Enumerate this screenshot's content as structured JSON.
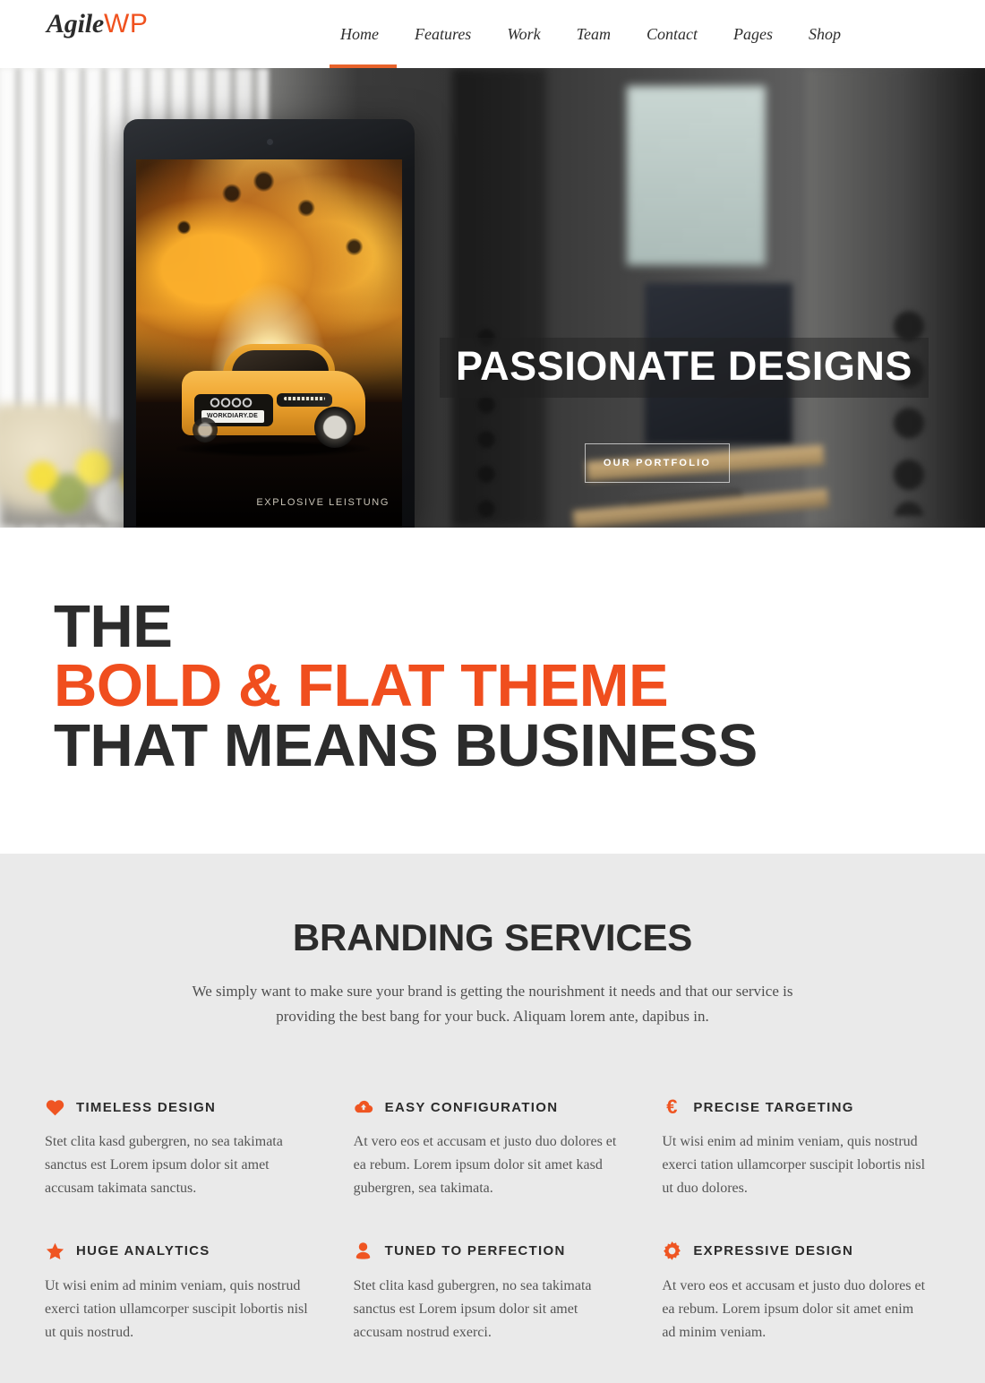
{
  "header": {
    "logo": {
      "part1": "Agile",
      "part2": "WP"
    },
    "nav": [
      {
        "label": "Home",
        "active": true
      },
      {
        "label": "Features",
        "active": false
      },
      {
        "label": "Work",
        "active": false
      },
      {
        "label": "Team",
        "active": false
      },
      {
        "label": "Contact",
        "active": false
      },
      {
        "label": "Pages",
        "active": false
      },
      {
        "label": "Shop",
        "active": false
      }
    ]
  },
  "hero": {
    "title": "PASSIONATE DESIGNS",
    "button_label": "OUR PORTFOLIO",
    "device": {
      "license_plate": "WORKDIARY.DE",
      "caption": "EXPLOSIVE LEISTUNG"
    }
  },
  "intro": {
    "line1": "THE",
    "line2": "BOLD & FLAT THEME",
    "line3": "THAT MEANS BUSINESS"
  },
  "services": {
    "heading": "BRANDING SERVICES",
    "lead": "We simply want to make sure your brand is getting the nourishment it needs and that our service is providing the best bang for your buck. Aliquam lorem ante, dapibus in.",
    "items": [
      {
        "icon": "heart-icon",
        "title": "TIMELESS DESIGN",
        "body": "Stet clita kasd gubergren, no sea takimata sanctus est Lorem ipsum dolor sit amet accusam takimata sanctus."
      },
      {
        "icon": "cloud-upload-icon",
        "title": "EASY CONFIGURATION",
        "body": "At vero eos et accusam et justo duo dolores et ea rebum. Lorem ipsum dolor sit amet kasd gubergren, sea takimata."
      },
      {
        "icon": "euro-icon",
        "title": "PRECISE TARGETING",
        "body": "Ut wisi enim ad minim veniam, quis nostrud exerci tation ullamcorper suscipit lobortis nisl ut duo dolores."
      },
      {
        "icon": "star-icon",
        "title": "HUGE ANALYTICS",
        "body": "Ut wisi enim ad minim veniam, quis nostrud exerci tation ullamcorper suscipit lobortis nisl ut quis nostrud."
      },
      {
        "icon": "user-icon",
        "title": "TUNED TO PERFECTION",
        "body": "Stet clita kasd gubergren, no sea takimata sanctus est Lorem ipsum dolor sit amet accusam nostrud exerci."
      },
      {
        "icon": "gear-icon",
        "title": "EXPRESSIVE DESIGN",
        "body": "At vero eos et accusam et justo duo dolores et ea rebum. Lorem ipsum dolor sit amet enim ad minim veniam."
      }
    ]
  },
  "colors": {
    "accent": "#f04e1e",
    "accent_icon": "#ef5522",
    "nav_underline": "#e8622a",
    "heading_dark": "#2c2c2c",
    "services_bg": "#eaeaea",
    "body_text": "#555555"
  }
}
